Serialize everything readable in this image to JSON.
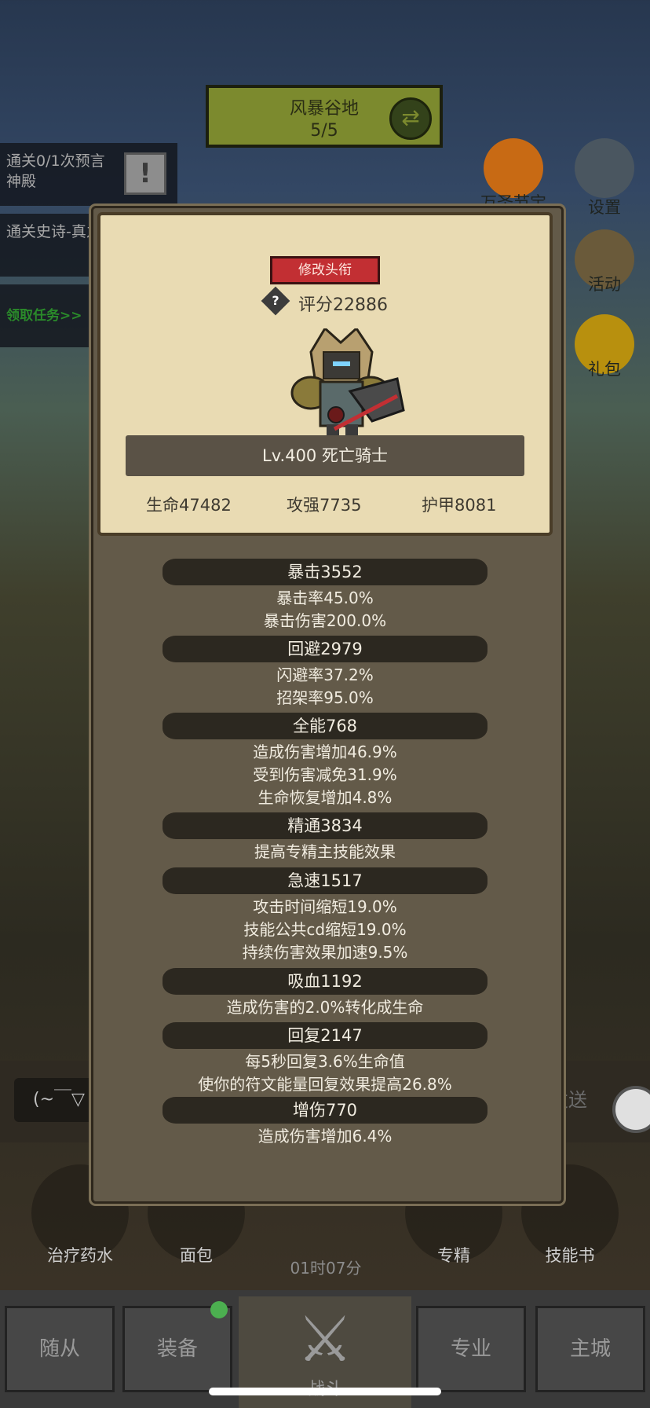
{
  "map": {
    "name": "风暴谷地",
    "progress": "5/5"
  },
  "quests": [
    {
      "text": "通关0/1次预言神殿"
    },
    {
      "text": "通关史诗-真之地"
    }
  ],
  "quest_claim": "领取任务>>",
  "right_icons": [
    {
      "label": "万圣节宝库",
      "icon": "pumpkin-icon"
    },
    {
      "label": "设置",
      "icon": "gear-icon"
    },
    {
      "label": "活动",
      "icon": "scroll-icon"
    },
    {
      "label": "礼包",
      "icon": "gift-icon"
    }
  ],
  "profile": {
    "change_title_button": "修改头衔",
    "score": "评分22886",
    "name": "Lv.400 死亡骑士",
    "hp": "生命47482",
    "attack": "攻强7735",
    "armor": "护甲8081"
  },
  "stats": [
    {
      "head": "暴击3552",
      "lines": [
        "暴击率45.0%",
        "暴击伤害200.0%"
      ]
    },
    {
      "head": "回避2979",
      "lines": [
        "闪避率37.2%",
        "招架率95.0%"
      ]
    },
    {
      "head": "全能768",
      "lines": [
        "造成伤害增加46.9%",
        "受到伤害减免31.9%",
        "生命恢复增加4.8%"
      ]
    },
    {
      "head": "精通3834",
      "lines": [
        "提高专精主技能效果"
      ]
    },
    {
      "head": "急速1517",
      "lines": [
        "攻击时间缩短19.0%",
        "技能公共cd缩短19.0%",
        "持续伤害效果加速9.5%"
      ]
    },
    {
      "head": "吸血1192",
      "lines": [
        "造成伤害的2.0%转化成生命"
      ]
    },
    {
      "head": "回复2147",
      "lines": [
        "每5秒回复3.6%生命值",
        "使你的符文能量回复效果提高26.8%"
      ]
    },
    {
      "head": "增伤770",
      "lines": [
        "造成伤害增加6.4%"
      ]
    }
  ],
  "chat": {
    "placeholder": "(~￣▽",
    "send": "发送"
  },
  "items": [
    "治疗药水",
    "面包",
    "专精",
    "技能书"
  ],
  "timer": "01时07分",
  "tabs": [
    "随从",
    "装备",
    "战斗",
    "专业",
    "主城"
  ]
}
